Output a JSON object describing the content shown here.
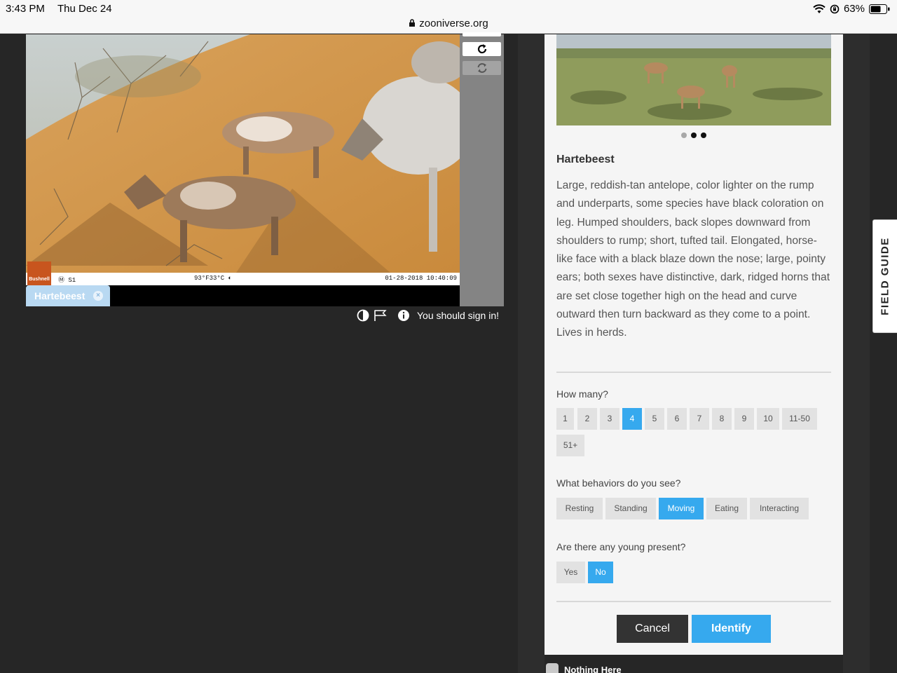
{
  "status_bar": {
    "time": "3:43 PM",
    "date": "Thu Dec 24",
    "url": "zooniverse.org",
    "battery": "63%",
    "icons": [
      "lock-icon",
      "wifi-icon",
      "orientation-lock-icon",
      "battery-icon"
    ]
  },
  "camera": {
    "station": "S1",
    "temperature": "93°F33°C",
    "timestamp": "01-28-2018 10:40:09",
    "brand": "Bushnell"
  },
  "toolbar": {
    "icons": [
      "rotate-icon",
      "reset-icon"
    ]
  },
  "selection": {
    "species_chip": "Hartebeest",
    "remove_icon": "close-icon"
  },
  "meta": {
    "icons": [
      "invert-icon",
      "flag-icon",
      "info-icon"
    ],
    "signin_text": "You should sign in!"
  },
  "species": {
    "name": "Hartebeest",
    "description": "Large, reddish-tan antelope, color lighter on the rump and underparts, some species have black coloration on leg. Humped shoulders, back slopes downward from shoulders to rump; short, tufted tail. Elongated, horse-like face with a black blaze down the nose; large, pointy ears; both sexes have distinctive, dark, ridged horns that are set close together high on the head and curve outward then turn backward as they come to a point. Lives in herds.",
    "carousel_active_index": 1
  },
  "questions": {
    "how_many": {
      "label": "How many?",
      "options": [
        "1",
        "2",
        "3",
        "4",
        "5",
        "6",
        "7",
        "8",
        "9",
        "10",
        "11-50",
        "51+"
      ],
      "selected": "4"
    },
    "behaviors": {
      "label": "What behaviors do you see?",
      "options": [
        "Resting",
        "Standing",
        "Moving",
        "Eating",
        "Interacting"
      ],
      "selected": "Moving"
    },
    "young": {
      "label": "Are there any young present?",
      "options": [
        "Yes",
        "No"
      ],
      "selected": "No"
    }
  },
  "actions": {
    "cancel": "Cancel",
    "identify": "Identify",
    "nothing_here": "Nothing Here"
  },
  "field_guide": {
    "label": "FIELD GUIDE"
  },
  "colors": {
    "accent": "#36a9ee",
    "panel_bg": "#f5f5f5",
    "page_bg": "#262626"
  }
}
